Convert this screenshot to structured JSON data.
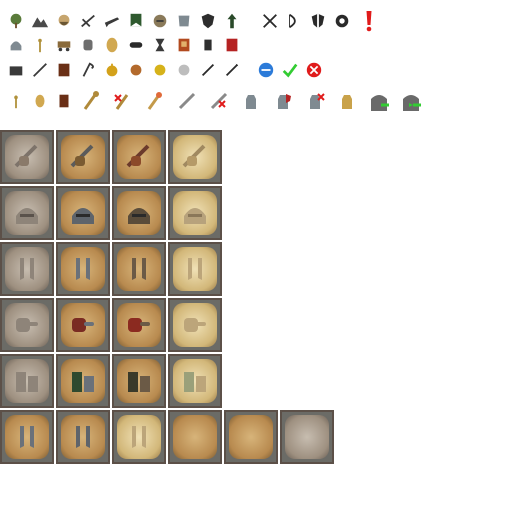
{
  "colors": {
    "tile_border": "#5c5048",
    "tile_bg": "#6b6b66",
    "gold": "#c9a24a",
    "steel": "#9aa3a9",
    "dark": "#2d2d2d",
    "red": "#e01b1b",
    "green": "#33cc33",
    "blue": "#2c7bd9"
  },
  "icon_rows": [
    {
      "name": "row-1",
      "icons": [
        "tree-icon",
        "mountains-icon",
        "bearded-face-icon",
        "crossbow-icon",
        "gun-icon",
        "banner-icon",
        "helmet-face-icon",
        "armor-icon",
        "shield-icon",
        "arrow-up-icon",
        "crossed-swords-icon",
        "bow-icon",
        "shield-split-icon",
        "gear-icon",
        "exclamation-icon"
      ]
    },
    {
      "name": "row-2",
      "icons": [
        "helmet-icon",
        "wheat-icon",
        "cart-icon",
        "fist-armor-icon",
        "bread-icon",
        "mask-icon",
        "hourglass-icon",
        "book-icon",
        "gauntlet-icon",
        "flag-icon"
      ]
    },
    {
      "name": "row-3",
      "icons": [
        "chest-icon",
        "sword-icon",
        "tome-icon",
        "scythe-icon",
        "crown-orb-icon",
        "copper-coin-icon",
        "gold-coin-icon",
        "silver-coin-icon",
        "dagger-icon",
        "spear-icon",
        "new-badge-icon",
        "checkmark-icon",
        "cancel-icon"
      ]
    },
    {
      "name": "row-4",
      "icons": [
        "wheat-small-icon",
        "bread-small-icon",
        "book-small-icon",
        "mace-icon",
        "mace-cancel-icon",
        "staff-icon",
        "short-sword-icon",
        "sword-cancel-icon",
        "gauntlet-steel-icon",
        "gauntlet-shield-icon",
        "gauntlet-cancel-icon",
        "gauntlet-gold-icon",
        "gate-enter-icon",
        "gate-exit-icon"
      ]
    }
  ],
  "tile_grid": {
    "rows": [
      {
        "name": "sword-hand-row",
        "tiles": [
          "gray",
          "normal",
          "normal",
          "pale"
        ]
      },
      {
        "name": "helmet-row",
        "tiles": [
          "gray",
          "normal",
          "normal",
          "pale"
        ]
      },
      {
        "name": "leg-armor-row",
        "tiles": [
          "gray",
          "normal",
          "normal",
          "pale"
        ]
      },
      {
        "name": "pointing-hand-row",
        "tiles": [
          "gray",
          "normal",
          "normal",
          "pale"
        ]
      },
      {
        "name": "tower-knight-row",
        "tiles": [
          "gray",
          "normal",
          "normal",
          "pale"
        ]
      },
      {
        "name": "greaves-row",
        "tiles": [
          "normal",
          "normal",
          "pale",
          "normal",
          "normal",
          "gray"
        ]
      }
    ]
  }
}
